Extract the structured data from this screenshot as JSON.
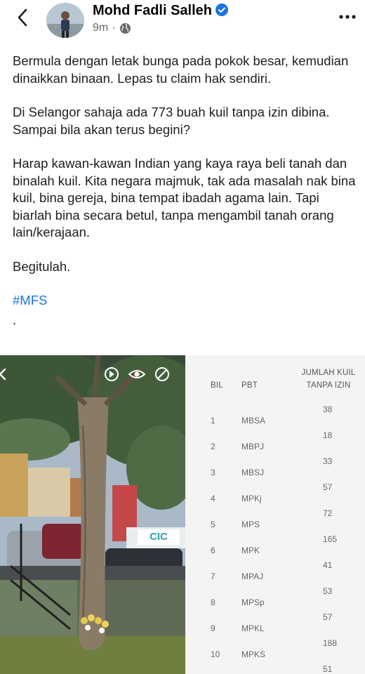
{
  "header": {
    "author_name": "Mohd Fadli Salleh",
    "time": "9m",
    "separator": "·",
    "icons": [
      "back-arrow-icon",
      "avatar",
      "verified-badge-icon",
      "globe-icon",
      "more-options-icon"
    ],
    "accent_color": "#1b74e4"
  },
  "post": {
    "paragraphs": [
      "Bermula dengan letak bunga pada pokok besar, kemudian dinaikkan binaan. Lepas tu claim hak sendiri.",
      "Di Selangor sahaja ada 773 buah kuil tanpa izin dibina. Sampai bila akan terus begini?",
      "Harap kawan-kawan Indian yang kaya raya beli tanah dan binalah kuil. Kita negara majmuk, tak ada masalah nak bina kuil, bina gereja, bina tempat ibadah agama lain. Tapi biarlah bina secara betul, tanpa mengambil tanah orang lain/kerajaan.",
      "Begitulah."
    ],
    "hashtag": "#MFS",
    "trailing": "."
  },
  "photo": {
    "sign_text": "CIC",
    "icons": [
      "back-chevron-icon",
      "spin-icon",
      "eye-icon",
      "no-eye-icon"
    ]
  },
  "table": {
    "headers": {
      "bil": "BIL",
      "pbt": "PBT",
      "jumlah_line1": "JUMLAH KUIL",
      "jumlah_line2": "TANPA IZIN"
    },
    "rows": [
      {
        "no": "1",
        "pbt": "MBSA",
        "val": "38"
      },
      {
        "no": "2",
        "pbt": "MBPJ",
        "val": "18"
      },
      {
        "no": "3",
        "pbt": "MBSJ",
        "val": "33"
      },
      {
        "no": "4",
        "pbt": "MPKj",
        "val": "57"
      },
      {
        "no": "5",
        "pbt": "MPS",
        "val": "72"
      },
      {
        "no": "6",
        "pbt": "MPK",
        "val": "165"
      },
      {
        "no": "7",
        "pbt": "MPAJ",
        "val": "41"
      },
      {
        "no": "8",
        "pbt": "MPSp",
        "val": "53"
      },
      {
        "no": "9",
        "pbt": "MPKL",
        "val": "57"
      },
      {
        "no": "10",
        "pbt": "MPKS",
        "val": "188"
      },
      {
        "no": "",
        "pbt": "",
        "val": "51"
      }
    ]
  }
}
